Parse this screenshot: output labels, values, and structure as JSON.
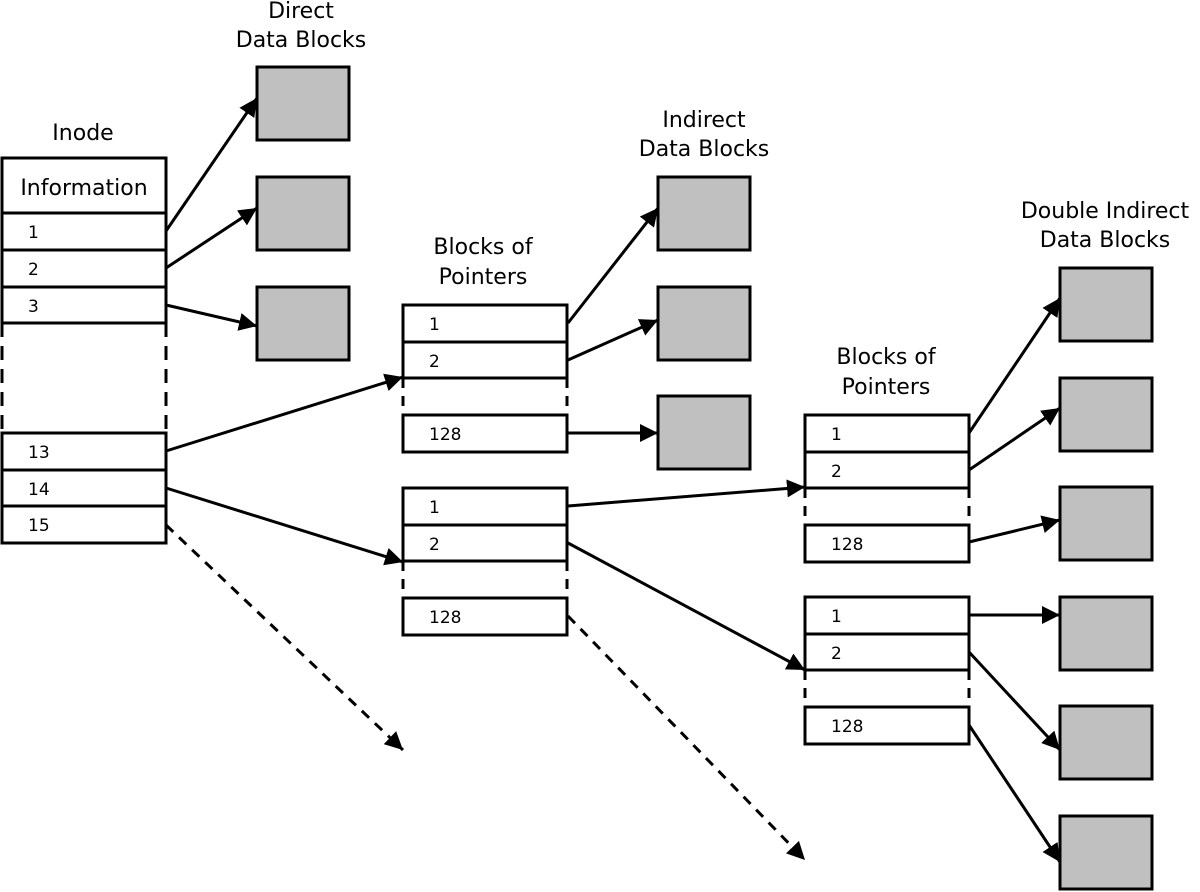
{
  "colors": {
    "data_block_fill": "#c0c0c0",
    "stroke": "#000000"
  },
  "labels": {
    "inode": "Inode",
    "information": "Information",
    "direct": [
      "Direct",
      "Data Blocks"
    ],
    "indirect": [
      "Indirect",
      "Data Blocks"
    ],
    "double_indirect": [
      "Double Indirect",
      "Data Blocks"
    ],
    "blocks_of_pointers": [
      "Blocks of",
      "Pointers"
    ]
  },
  "inode_rows": [
    "1",
    "2",
    "3",
    "13",
    "14",
    "15"
  ],
  "pointer_block_rows": [
    "1",
    "2",
    "128"
  ]
}
